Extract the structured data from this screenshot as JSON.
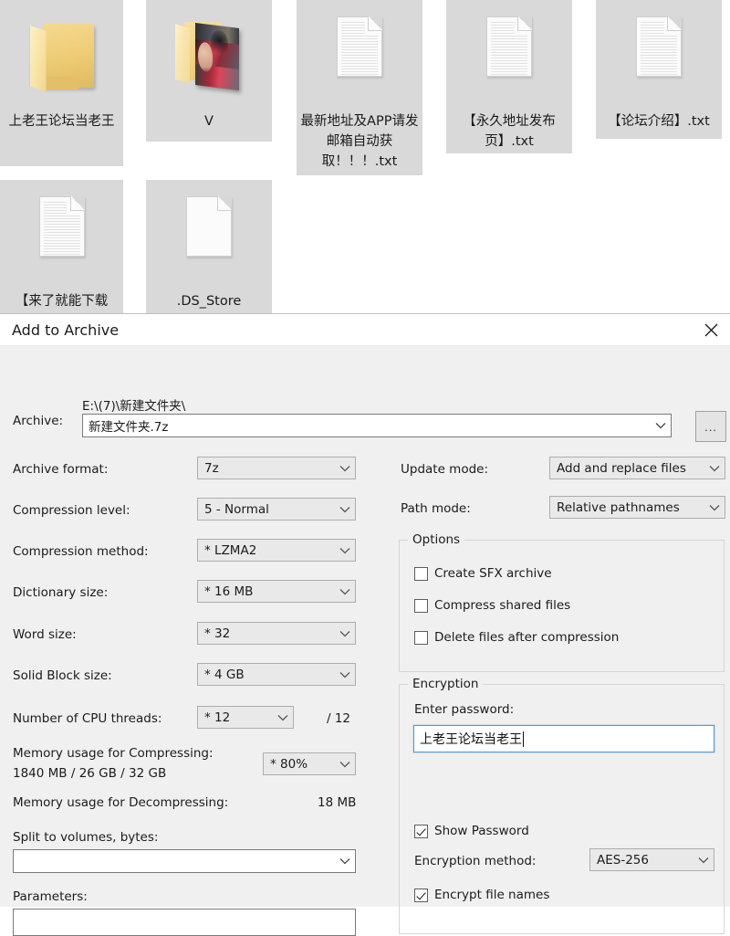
{
  "desktop": {
    "files": [
      {
        "name": "上老王论坛当老王",
        "type": "folder"
      },
      {
        "name": "V",
        "type": "folder-photo"
      },
      {
        "name": "最新地址及APP请发邮箱自动获取！！！.txt",
        "type": "text-document"
      },
      {
        "name": "【永久地址发布页】.txt",
        "type": "text-document"
      },
      {
        "name": "【论坛介绍】.txt",
        "type": "text-document"
      },
      {
        "name": "【来了就能下载",
        "type": "text-document"
      },
      {
        "name": ".DS_Store",
        "type": "blank-document"
      }
    ]
  },
  "dialog": {
    "title": "Add to Archive",
    "close_icon": "close-icon",
    "archive": {
      "label": "Archive:",
      "path": "E:\\(7)\\新建文件夹\\",
      "filename": "新建文件夹.7z",
      "browse_label": "..."
    },
    "left_fields": [
      {
        "label": "Archive format:",
        "value": "7z"
      },
      {
        "label": "Compression level:",
        "value": "5 - Normal"
      },
      {
        "label": "Compression method:",
        "value": "*  LZMA2"
      },
      {
        "label": "Dictionary size:",
        "value": "*  16 MB"
      },
      {
        "label": "Word size:",
        "value": "*  32"
      },
      {
        "label": "Solid Block size:",
        "value": "*  4 GB"
      }
    ],
    "cpu": {
      "label": "Number of CPU threads:",
      "value": "*  12",
      "total": "/ 12"
    },
    "memory_compress": {
      "label": "Memory usage for Compressing:",
      "detail": "1840 MB / 26 GB / 32 GB",
      "percent": "* 80%"
    },
    "memory_decompress": {
      "label": "Memory usage for Decompressing:",
      "value": "18 MB"
    },
    "split": {
      "label": "Split to volumes, bytes:",
      "value": ""
    },
    "parameters": {
      "label": "Parameters:",
      "value": ""
    },
    "right_fields": [
      {
        "label": "Update mode:",
        "value": "Add and replace files"
      },
      {
        "label": "Path mode:",
        "value": "Relative pathnames"
      }
    ],
    "options": {
      "title": "Options",
      "items": [
        {
          "label": "Create SFX archive",
          "checked": false
        },
        {
          "label": "Compress shared files",
          "checked": false
        },
        {
          "label": "Delete files after compression",
          "checked": false
        }
      ]
    },
    "encryption": {
      "title": "Encryption",
      "password_label": "Enter password:",
      "password_value": "上老王论坛当老王",
      "show_password": {
        "label": "Show Password",
        "checked": true
      },
      "method_label": "Encryption method:",
      "method_value": "AES-256",
      "encrypt_names": {
        "label": "Encrypt file names",
        "checked": true
      }
    }
  }
}
